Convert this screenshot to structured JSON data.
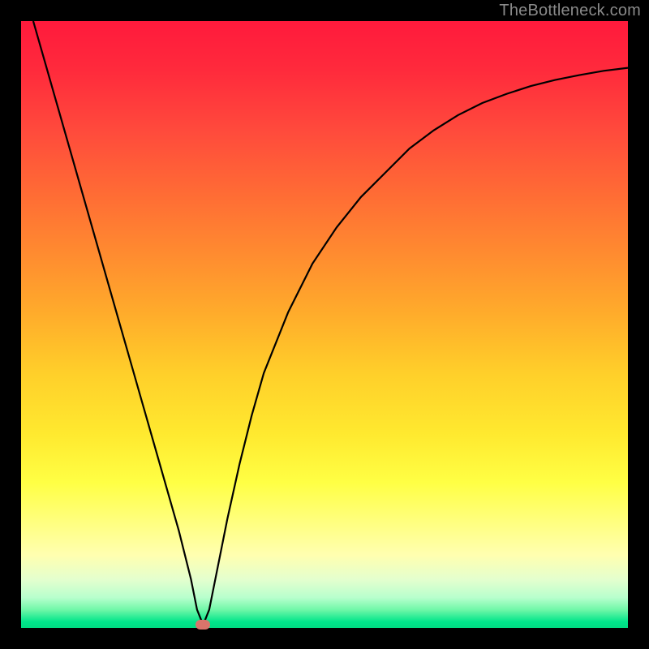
{
  "watermark": "TheBottleneck.com",
  "chart_data": {
    "type": "line",
    "title": "",
    "xlabel": "",
    "ylabel": "",
    "xlim": [
      0,
      100
    ],
    "ylim": [
      0,
      100
    ],
    "series": [
      {
        "name": "curve",
        "x": [
          2,
          4,
          6,
          8,
          10,
          12,
          14,
          16,
          18,
          20,
          22,
          24,
          26,
          28,
          29,
          30,
          31,
          32,
          34,
          36,
          38,
          40,
          44,
          48,
          52,
          56,
          60,
          64,
          68,
          72,
          76,
          80,
          84,
          88,
          92,
          96,
          100
        ],
        "values": [
          100,
          93,
          86,
          79,
          72,
          65,
          58,
          51,
          44,
          37,
          30,
          23,
          16,
          8,
          3,
          0.5,
          3,
          8,
          18,
          27,
          35,
          42,
          52,
          60,
          66,
          71,
          75,
          79,
          82,
          84.5,
          86.5,
          88,
          89.3,
          90.3,
          91.1,
          91.8,
          92.3
        ]
      }
    ],
    "marker": {
      "x": 30,
      "y": 0.5,
      "color": "#d9746b"
    },
    "background_gradient": {
      "top": "#ff1a3c",
      "mid_upper": "#ffab2b",
      "mid": "#ffff44",
      "lower": "#b8ffcd",
      "bottom": "#00db82"
    }
  }
}
